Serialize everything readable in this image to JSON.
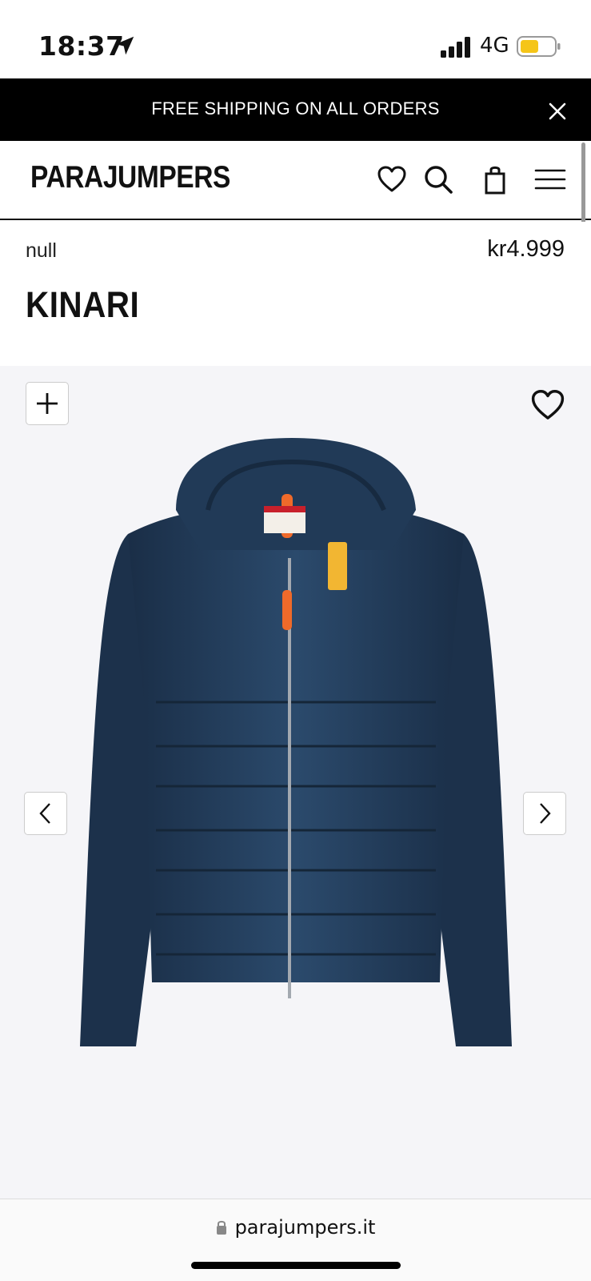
{
  "status_bar": {
    "time": "18:37",
    "network": "4G",
    "battery_color": "#f5c518",
    "icons": [
      "location-arrow-icon",
      "signal-bars-icon",
      "battery-icon"
    ]
  },
  "promo_banner": {
    "text": "FREE SHIPPING ON ALL ORDERS",
    "close_icon": "close-icon"
  },
  "header": {
    "logo": "PARAJUMPERS",
    "icons": [
      "heart-icon",
      "search-icon",
      "bag-icon",
      "menu-icon"
    ]
  },
  "product": {
    "category": "null",
    "price": "kr4.999",
    "name": "KINARI"
  },
  "gallery": {
    "image": "navy hybrid down jacket with hood",
    "jacket_color": "#1e3550",
    "icons": [
      "plus-icon",
      "heart-icon",
      "chevron-left-icon",
      "chevron-right-icon"
    ]
  },
  "browser": {
    "url": "parajumpers.it",
    "icons": [
      "lock-icon"
    ]
  }
}
